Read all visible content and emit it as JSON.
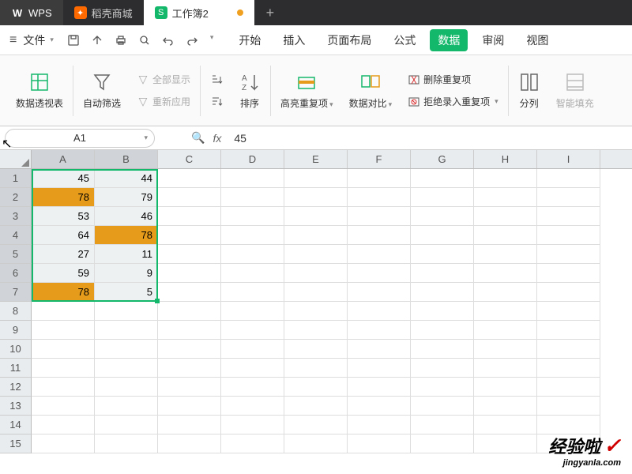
{
  "titlebar": {
    "wps_label": "WPS",
    "docker_label": "稻壳商城",
    "workbook_label": "工作簿2",
    "newtab": "+"
  },
  "menubar": {
    "file": "文件",
    "items": [
      "开始",
      "插入",
      "页面布局",
      "公式",
      "数据",
      "审阅",
      "视图"
    ],
    "active_index": 4
  },
  "ribbon": {
    "pivot": "数据透视表",
    "autofilter": "自动筛选",
    "showall": "全部显示",
    "reapply": "重新应用",
    "sort": "排序",
    "highlight_dup": "高亮重复项",
    "compare": "数据对比",
    "remove_dup": "删除重复项",
    "reject_dup": "拒绝录入重复项",
    "split": "分列",
    "smartfill": "智能填充"
  },
  "formula_bar": {
    "cell_ref": "A1",
    "fx": "fx",
    "value": "45"
  },
  "grid": {
    "columns": [
      "A",
      "B",
      "C",
      "D",
      "E",
      "F",
      "G",
      "H",
      "I"
    ],
    "row_count": 15,
    "data": [
      {
        "A": "45",
        "B": "44"
      },
      {
        "A": "78",
        "B": "79",
        "hlA": true
      },
      {
        "A": "53",
        "B": "46"
      },
      {
        "A": "64",
        "B": "78",
        "hlB": true
      },
      {
        "A": "27",
        "B": "11"
      },
      {
        "A": "59",
        "B": "9"
      },
      {
        "A": "78",
        "B": "5",
        "hlA": true
      }
    ],
    "selection": {
      "top_row": 1,
      "bottom_row": 7,
      "left_col": "A",
      "right_col": "B"
    }
  },
  "watermark": {
    "title": "经验啦",
    "url": "jingyanla.com"
  },
  "chart_data": {
    "type": "table",
    "columns": [
      "A",
      "B"
    ],
    "rows": [
      [
        45,
        44
      ],
      [
        78,
        79
      ],
      [
        53,
        46
      ],
      [
        64,
        78
      ],
      [
        27,
        11
      ],
      [
        59,
        9
      ],
      [
        78,
        5
      ]
    ],
    "highlighted_cells": [
      "A2",
      "B4",
      "A7"
    ],
    "selected_range": "A1:B7",
    "active_cell": "A1"
  }
}
